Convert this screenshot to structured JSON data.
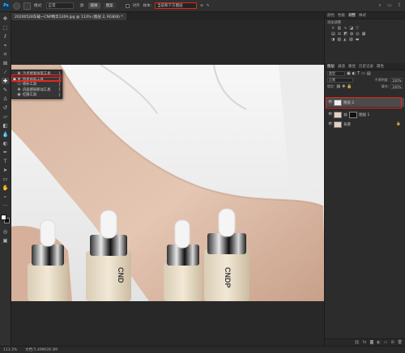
{
  "app": {
    "logo_text": "Ps"
  },
  "options_bar": {
    "mode_label": "模式:",
    "mode_value": "正常",
    "btn_source": "取样",
    "btn_pattern": "图案",
    "check_aligned": "对齐",
    "sample_label": "样本:",
    "sample_value": "当前和下方图层",
    "sample_dropdown_highlighted": true
  },
  "document_tab": {
    "title": "20200528车载一CNP精华1269.jpg @ 113% (图层 2, RGB/8) *"
  },
  "flyout": {
    "items": [
      {
        "label": "污点修复画笔工具",
        "shortcut": "J",
        "icon": "spot-healing-icon"
      },
      {
        "label": "修复画笔工具",
        "shortcut": "J",
        "icon": "healing-brush-icon",
        "selected": true
      },
      {
        "label": "修补工具",
        "shortcut": "J",
        "icon": "patch-icon"
      },
      {
        "label": "内容感知移动工具",
        "shortcut": "J",
        "icon": "content-aware-move-icon"
      },
      {
        "label": "红眼工具",
        "shortcut": "J",
        "icon": "red-eye-icon"
      }
    ]
  },
  "canvas_image": {
    "bottle_label_1": "CND",
    "bottle_label_2": "CNDP"
  },
  "panels": {
    "top_tabs": [
      "颜色",
      "色板",
      "调整",
      "样式"
    ],
    "adjust_title": "添加调整",
    "layer_tabs": [
      "图层",
      "通道",
      "路径",
      "历史记录",
      "属性"
    ],
    "kind_label": "类型",
    "blend_mode": "正常",
    "opacity_label": "不透明度:",
    "opacity_value": "100%",
    "lock_label": "锁定:",
    "fill_label": "填充:",
    "fill_value": "100%",
    "layers": [
      {
        "name": "图层 2",
        "selected": true,
        "highlighted": true
      },
      {
        "name": "图层 1",
        "has_mask": true
      },
      {
        "name": "背景",
        "locked": true
      }
    ]
  },
  "statusbar": {
    "zoom": "113.3%",
    "doc": "文档:5.49M/28.3M"
  },
  "colors": {
    "highlight": "#e5261f",
    "panel_bg": "#2c2c2c",
    "workspace": "#282828"
  }
}
